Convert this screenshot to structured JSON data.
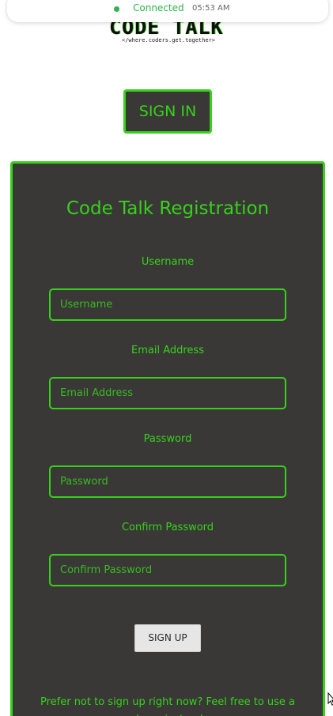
{
  "status": {
    "connection": "Connected",
    "time": "05:53 AM"
  },
  "logo": {
    "word": "CODE TALK",
    "tagline": "</where.coders.get.together>"
  },
  "header": {
    "signin_label": "SIGN IN"
  },
  "registration": {
    "title": "Code Talk Registration",
    "fields": [
      {
        "label": "Username",
        "placeholder": "Username",
        "value": ""
      },
      {
        "label": "Email Address",
        "placeholder": "Email Address",
        "value": ""
      },
      {
        "label": "Password",
        "placeholder": "Password",
        "value": ""
      },
      {
        "label": "Confirm Password",
        "placeholder": "Confirm Password",
        "value": ""
      }
    ],
    "signup_label": "SIGN UP",
    "demo_text": "Prefer not to sign up right now? Feel free to use a demo instead"
  },
  "colors": {
    "accent": "#36d11a",
    "card_background": "#3a3837",
    "status_green": "#2fb34a"
  }
}
